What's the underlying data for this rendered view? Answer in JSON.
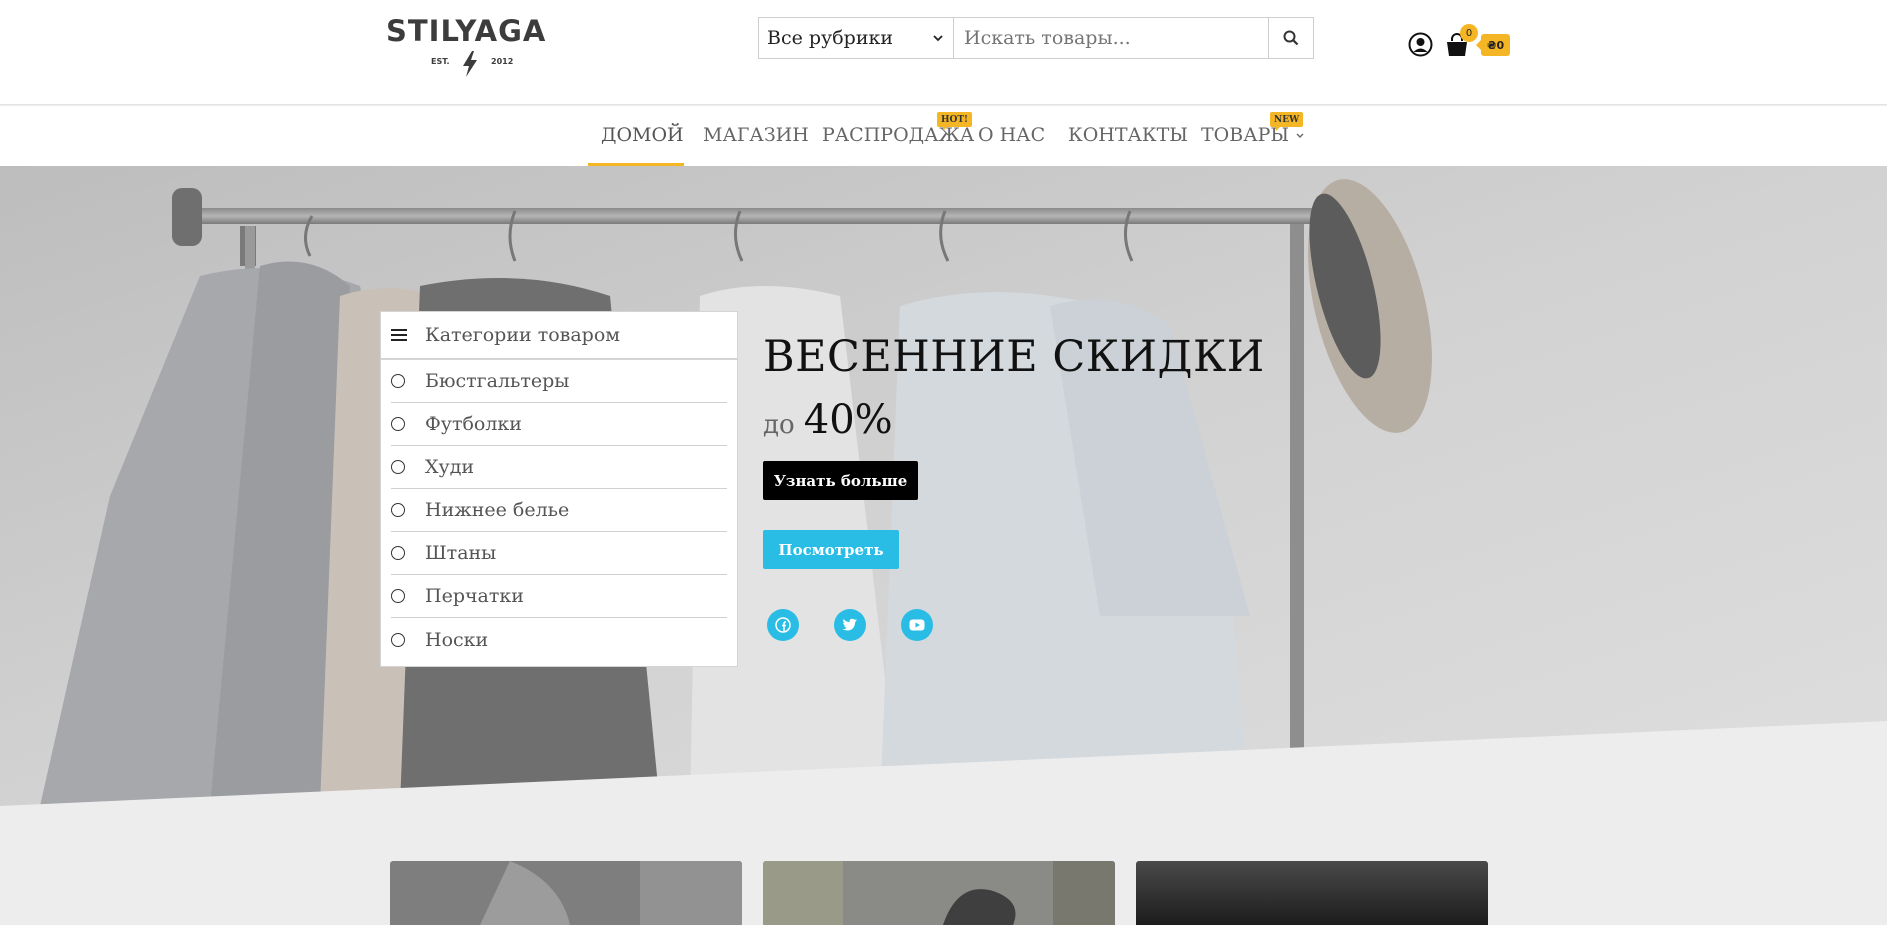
{
  "header": {
    "logo": {
      "word": "STILYAGA",
      "est": "EST.",
      "year": "2012"
    },
    "search": {
      "category_selected": "Все рубрики",
      "placeholder": "Искать товары..."
    },
    "cart": {
      "count": "0",
      "total": "₴0"
    }
  },
  "nav": {
    "items": [
      {
        "label": "Домой",
        "active": true
      },
      {
        "label": "Магазин"
      },
      {
        "label": "Распродажа",
        "badge": "HOT!"
      },
      {
        "label": "О нас"
      },
      {
        "label": "Контакты"
      },
      {
        "label": "Товары",
        "badge": "NEW",
        "dropdown": true
      }
    ]
  },
  "categories": {
    "title": "Категории товаром",
    "items": [
      "Бюстгальтеры",
      "Футболки",
      "Худи",
      "Нижнее белье",
      "Штаны",
      "Перчатки",
      "Носки"
    ]
  },
  "hero": {
    "title": "ВЕСЕННИЕ СКИДКИ",
    "upto": "до",
    "percent": "40%",
    "primary_button": "Узнать больше",
    "secondary_button": "Посмотреть",
    "social": [
      "facebook-icon",
      "twitter-icon",
      "youtube-icon"
    ]
  },
  "colors": {
    "accent": "#f5b625",
    "cyan": "#29bde6"
  }
}
